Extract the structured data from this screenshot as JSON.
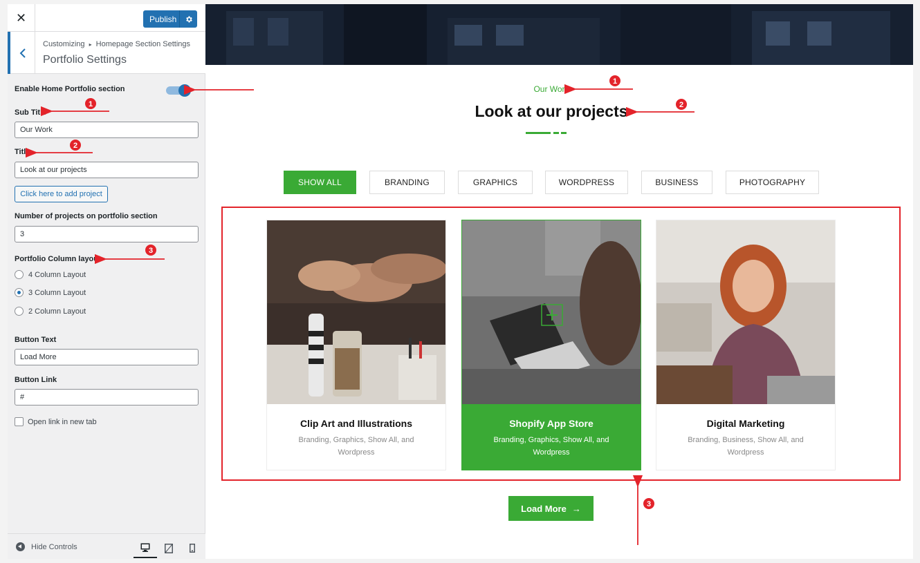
{
  "sidebar": {
    "close_label": "✕",
    "publish_label": "Publish",
    "breadcrumb_root": "Customizing",
    "breadcrumb_sep": "▸",
    "breadcrumb_section": "Homepage Section Settings",
    "section_title": "Portfolio Settings",
    "enable_label": "Enable Home Portfolio section",
    "enable_on": true,
    "subtitle_label": "Sub Title",
    "subtitle_value": "Our Work",
    "title_label": "Title",
    "title_value": "Look at our projects",
    "add_project_label": "Click here to add project",
    "num_projects_label": "Number of projects on portfolio section",
    "num_projects_value": "3",
    "column_layout_label": "Portfolio Column layout",
    "column_options": [
      "4 Column Layout",
      "3 Column Layout",
      "2 Column Layout"
    ],
    "column_selected": "3 Column Layout",
    "button_text_label": "Button Text",
    "button_text_value": "Load More",
    "button_link_label": "Button Link",
    "button_link_value": "#",
    "new_tab_label": "Open link in new tab",
    "hide_controls_label": "Hide Controls"
  },
  "preview": {
    "subtitle": "Our Work",
    "title": "Look at our projects",
    "filters": [
      "SHOW ALL",
      "BRANDING",
      "GRAPHICS",
      "WORDPRESS",
      "BUSINESS",
      "PHOTOGRAPHY"
    ],
    "active_filter": "SHOW ALL",
    "projects": [
      {
        "title": "Clip Art and Illustrations",
        "tags": "Branding, Graphics, Show All, and Wordpress"
      },
      {
        "title": "Shopify App Store",
        "tags": "Branding, Graphics, Show All, and Wordpress"
      },
      {
        "title": "Digital Marketing",
        "tags": "Branding, Business, Show All, and Wordpress"
      }
    ],
    "load_more_label": "Load More",
    "load_more_arrow": "→"
  },
  "annotations": [
    "1",
    "2",
    "3"
  ],
  "colors": {
    "accent_green": "#3aaa35",
    "wp_blue": "#2271b1",
    "annotation_red": "#e3232a"
  }
}
